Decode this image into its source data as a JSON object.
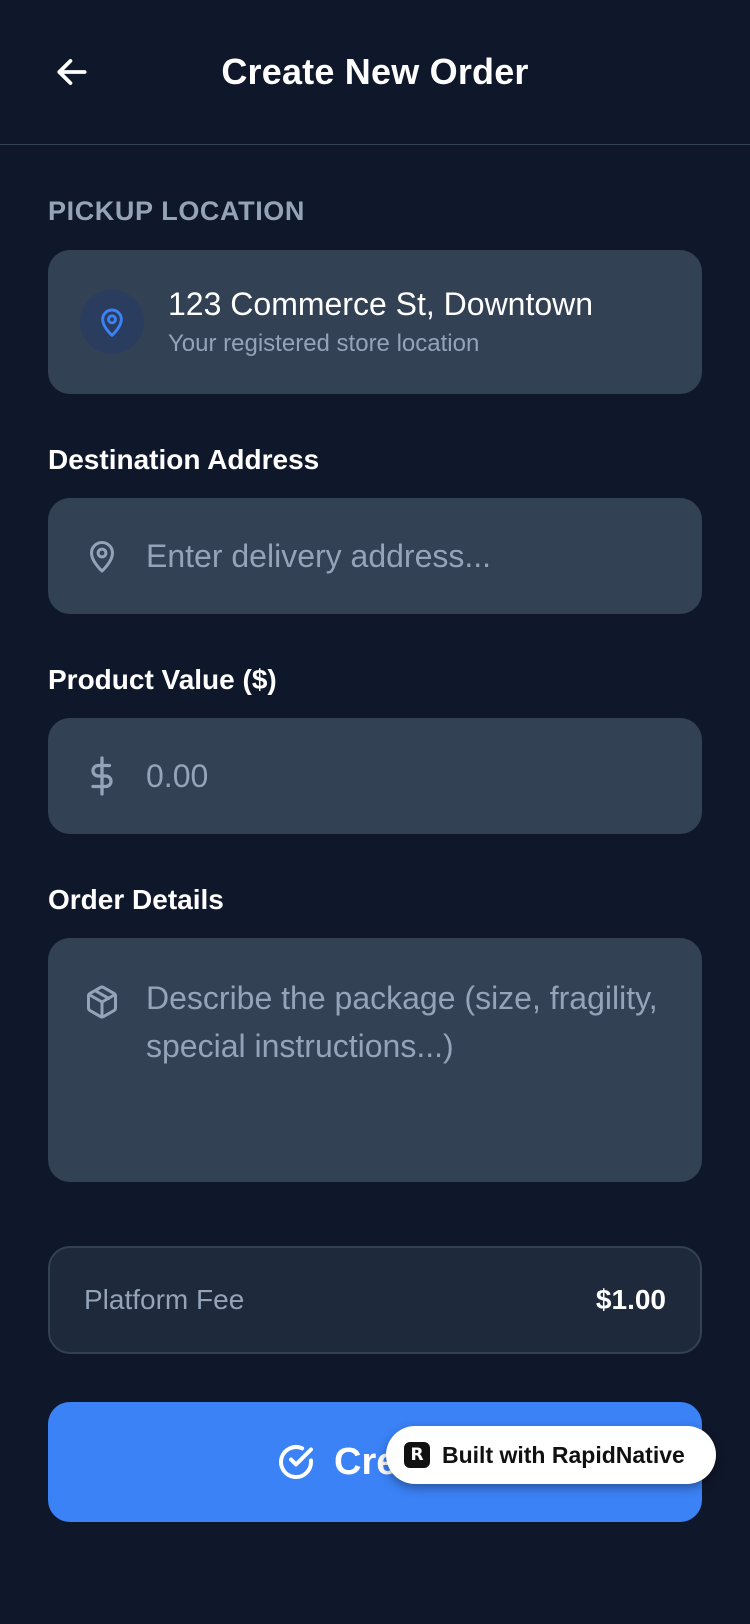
{
  "header": {
    "title": "Create New Order",
    "back_icon": "arrow-left-icon"
  },
  "pickup": {
    "section_label": "PICKUP LOCATION",
    "address": "123 Commerce St, Downtown",
    "subtitle": "Your registered store location",
    "icon": "map-pin-icon"
  },
  "destination": {
    "label": "Destination Address",
    "placeholder": "Enter delivery address...",
    "icon": "map-pin-icon"
  },
  "product_value": {
    "label": "Product Value ($)",
    "placeholder": "0.00",
    "icon": "dollar-icon"
  },
  "order_details": {
    "label": "Order Details",
    "placeholder": "Describe the package (size, fragility, special instructions...)",
    "icon": "package-icon"
  },
  "fee": {
    "label": "Platform Fee",
    "value": "$1.00"
  },
  "submit": {
    "label": "Create Order",
    "icon": "check-circle-icon"
  },
  "badge": {
    "text": "Built with RapidNative",
    "logo": "R"
  },
  "colors": {
    "background": "#0f172a",
    "card": "#334155",
    "accent": "#3b82f6",
    "muted_text": "#94a3b8"
  }
}
